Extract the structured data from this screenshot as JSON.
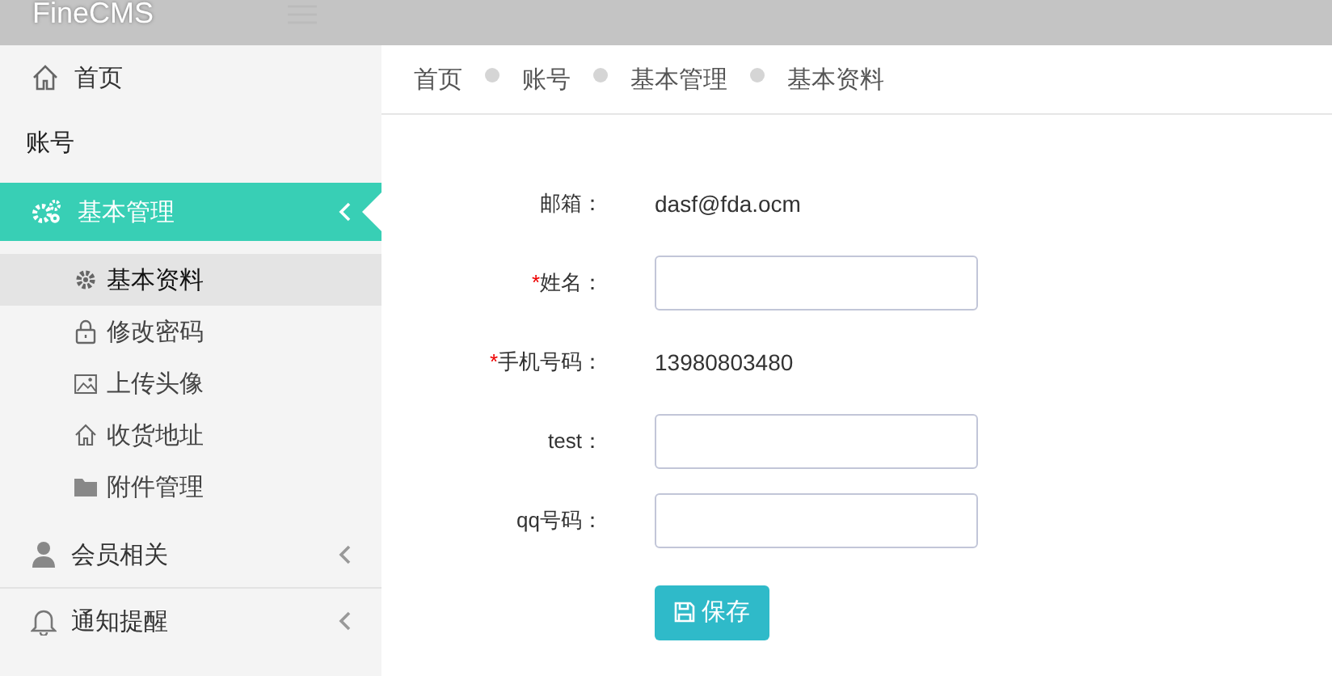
{
  "header": {
    "brand": "FineCMS"
  },
  "sidebar": {
    "items": [
      {
        "kind": "link",
        "label": "首页"
      },
      {
        "kind": "header",
        "label": "账号"
      },
      {
        "kind": "group",
        "label": "基本管理",
        "selected": true,
        "expanded": true,
        "children": [
          {
            "label": "基本资料",
            "selected": true
          },
          {
            "label": "修改密码",
            "selected": false
          },
          {
            "label": "上传头像",
            "selected": false
          },
          {
            "label": "收货地址",
            "selected": false
          },
          {
            "label": "附件管理",
            "selected": false
          }
        ]
      },
      {
        "kind": "group",
        "label": "会员相关",
        "selected": false,
        "expanded": false
      },
      {
        "kind": "group",
        "label": "通知提醒",
        "selected": false,
        "expanded": false
      }
    ]
  },
  "breadcrumb": [
    "首页",
    "账号",
    "基本管理",
    "基本资料"
  ],
  "form": {
    "fields": [
      {
        "kind": "text",
        "label": "邮箱：",
        "value": "dasf@fda.ocm"
      },
      {
        "kind": "input",
        "label": "姓名：",
        "required_mark": "*"
      },
      {
        "kind": "text",
        "label": "手机号码：",
        "required_mark": "*",
        "value": "13980803480"
      },
      {
        "kind": "input",
        "label": "test："
      },
      {
        "kind": "input",
        "label": "qq号码："
      }
    ],
    "submit": "保存"
  }
}
